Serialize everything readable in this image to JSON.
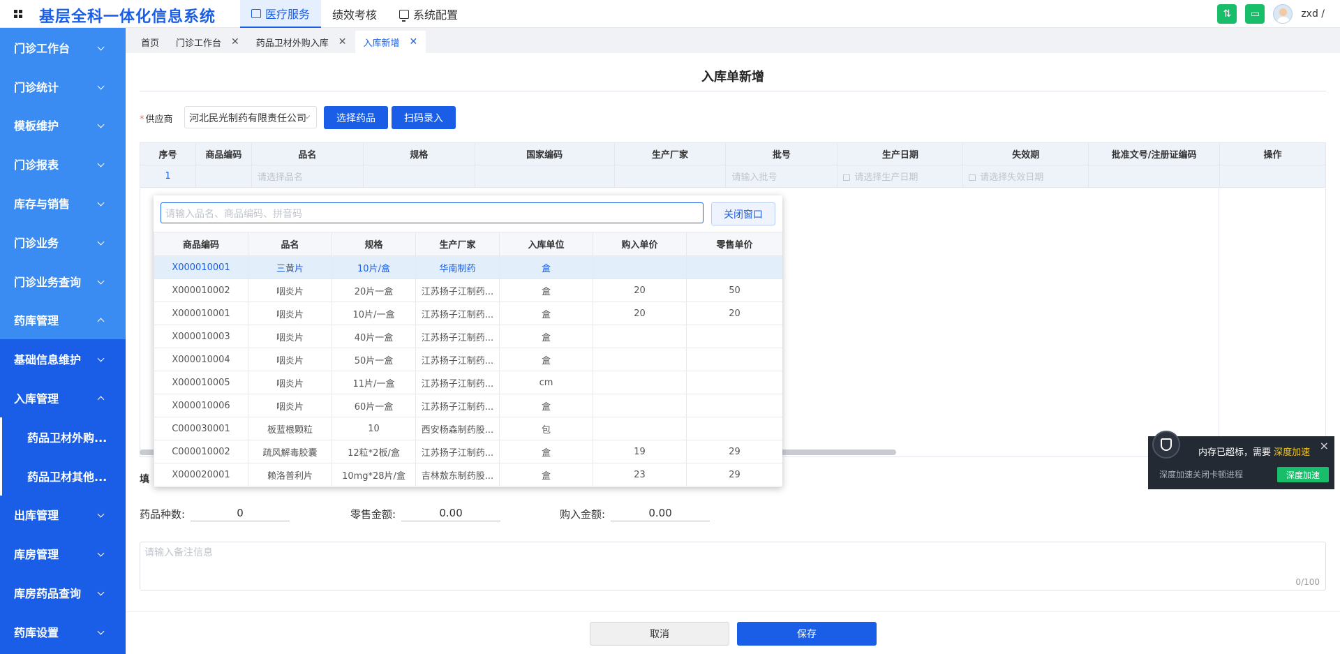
{
  "app": {
    "title": "基层全科一体化信息系统"
  },
  "topnav": [
    {
      "label": "医疗服务",
      "icon": "medical-box-icon",
      "active": true
    },
    {
      "label": "绩效考核",
      "icon": "",
      "active": false
    },
    {
      "label": "系统配置",
      "icon": "monitor-icon",
      "active": false
    }
  ],
  "user": {
    "name": "zxd /"
  },
  "sidebar": {
    "items": [
      {
        "label": "门诊工作台"
      },
      {
        "label": "门诊统计"
      },
      {
        "label": "模板维护"
      },
      {
        "label": "门诊报表"
      },
      {
        "label": "库存与销售"
      },
      {
        "label": "门诊业务"
      },
      {
        "label": "门诊业务查询"
      },
      {
        "label": "药库管理"
      },
      {
        "label": "基础信息维护"
      },
      {
        "label": "入库管理"
      },
      {
        "label": "药品卫材外购..."
      },
      {
        "label": "药品卫材其他..."
      },
      {
        "label": "出库管理"
      },
      {
        "label": "库房管理"
      },
      {
        "label": "库房药品查询"
      },
      {
        "label": "药库设置"
      }
    ]
  },
  "tabs": [
    {
      "label": "首页"
    },
    {
      "label": "门诊工作台"
    },
    {
      "label": "药品卫材外购入库"
    },
    {
      "label": "入库新增"
    }
  ],
  "page": {
    "title": "入库单新增",
    "supplier_label": "供应商",
    "supplier_required": "*",
    "supplier_value": "河北民光制药有限责任公司",
    "select_drug_btn": "选择药品",
    "scan_btn": "扫码录入"
  },
  "main_table": {
    "headers": [
      "序号",
      "商品编码",
      "品名",
      "规格",
      "国家编码",
      "生产厂家",
      "批号",
      "生产日期",
      "失效期",
      "批准文号/注册证编码",
      "操作"
    ],
    "row": {
      "index": "1",
      "name_placeholder": "请选择品名",
      "batch_placeholder": "请输入批号",
      "prod_date_placeholder": "请选择生产日期",
      "expiry_placeholder": "请选择失效日期"
    }
  },
  "fill_label": "填",
  "summary": {
    "kinds_label": "药品种数:",
    "kinds_value": "0",
    "retail_label": "零售金额:",
    "retail_value": "0.00",
    "purchase_label": "购入金额:",
    "purchase_value": "0.00"
  },
  "remark": {
    "placeholder": "请输入备注信息",
    "count": "0/100"
  },
  "buttons": {
    "cancel": "取消",
    "save": "保存"
  },
  "popup": {
    "search_placeholder": "请输入品名、商品编码、拼音码",
    "close_label": "关闭窗口",
    "headers": [
      "商品编码",
      "品名",
      "规格",
      "生产厂家",
      "入库单位",
      "购入单价",
      "零售单价"
    ],
    "rows": [
      [
        "X000010001",
        "三黄片",
        "10片/盒",
        "华南制药",
        "盒",
        "",
        ""
      ],
      [
        "X000010002",
        "咽炎片",
        "20片一盒",
        "江苏扬子江制药...",
        "盒",
        "20",
        "50"
      ],
      [
        "X000010001",
        "咽炎片",
        "10片/一盒",
        "江苏扬子江制药...",
        "盒",
        "20",
        "20"
      ],
      [
        "X000010003",
        "咽炎片",
        "40片一盒",
        "江苏扬子江制药...",
        "盒",
        "",
        ""
      ],
      [
        "X000010004",
        "咽炎片",
        "50片一盒",
        "江苏扬子江制药...",
        "盒",
        "",
        ""
      ],
      [
        "X000010005",
        "咽炎片",
        "11片/一盒",
        "江苏扬子江制药...",
        "cm",
        "",
        ""
      ],
      [
        "X000010006",
        "咽炎片",
        "60片一盒",
        "江苏扬子江制药...",
        "盒",
        "",
        ""
      ],
      [
        "C000030001",
        "板蓝根颗粒",
        "10",
        "西安杨森制药股...",
        "包",
        "",
        ""
      ],
      [
        "C000010002",
        "疏风解毒胶囊",
        "12粒*2板/盒",
        "江苏扬子江制药...",
        "盒",
        "19",
        "29"
      ],
      [
        "X000020001",
        "赖洛普利片",
        "10mg*28片/盒",
        "吉林敖东制药股...",
        "盒",
        "23",
        "29"
      ]
    ]
  },
  "toast": {
    "message": "内存已超标，需要",
    "highlight": "深度加速",
    "sub": "深度加速关闭卡顿进程",
    "action": "深度加速",
    "close": "×"
  }
}
